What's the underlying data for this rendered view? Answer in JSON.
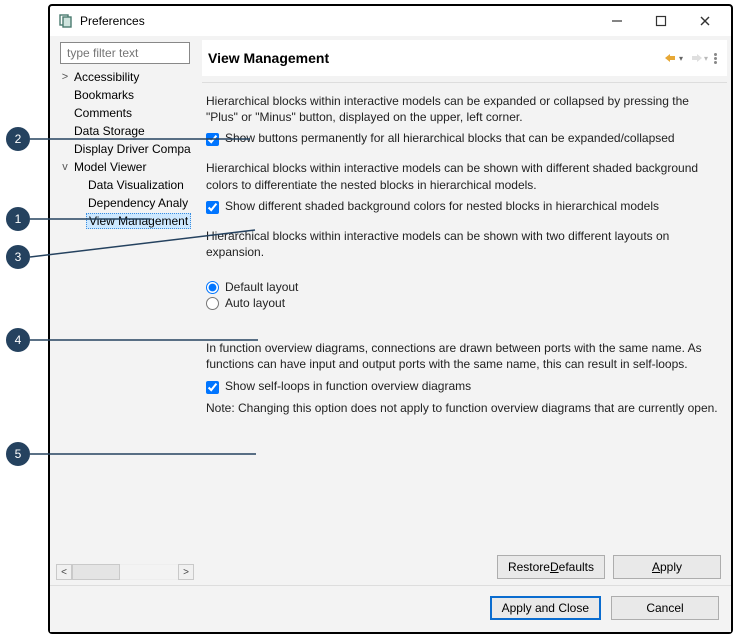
{
  "window": {
    "title": "Preferences"
  },
  "filter_placeholder": "type filter text",
  "tree": {
    "items": [
      {
        "label": "Accessibility",
        "indent": 1,
        "twisty": ">"
      },
      {
        "label": "Bookmarks",
        "indent": 1,
        "twisty": ""
      },
      {
        "label": "Comments",
        "indent": 1,
        "twisty": ""
      },
      {
        "label": "Data Storage",
        "indent": 1,
        "twisty": ""
      },
      {
        "label": "Display Driver Compa",
        "indent": 1,
        "twisty": ""
      },
      {
        "label": "Model Viewer",
        "indent": 1,
        "twisty": "v"
      },
      {
        "label": "Data Visualization",
        "indent": 2,
        "twisty": ""
      },
      {
        "label": "Dependency Analy",
        "indent": 2,
        "twisty": ""
      },
      {
        "label": "View Management",
        "indent": 2,
        "twisty": "",
        "selected": true
      }
    ]
  },
  "header": {
    "title": "View Management"
  },
  "sections": {
    "buttons_desc": "Hierarchical blocks within interactive models can be expanded or collapsed by pressing the \"Plus\" or \"Minus\" button, displayed on the upper, left corner.",
    "buttons_check": "Show buttons permanently for all hierarchical blocks that can be expanded/collapsed",
    "shading_desc": "Hierarchical blocks within interactive models can be shown with different shaded background colors to differentiate the nested blocks in hierarchical models.",
    "shading_check": "Show different shaded background colors for nested blocks in hierarchical models",
    "layout_desc": "Hierarchical blocks within interactive models can be shown with two different layouts on expansion.",
    "layout_default": "Default layout",
    "layout_auto": "Auto layout",
    "selfloop_desc": "In function overview diagrams, connections are drawn between ports with the same name. As functions can have input and output ports with the same name, this can result in self-loops.",
    "selfloop_check": "Show self-loops in function overview diagrams",
    "selfloop_note": "Note: Changing this option does not apply to function overview diagrams that are currently open."
  },
  "buttons": {
    "restore_pre": "Restore ",
    "restore_ul": "D",
    "restore_post": "efaults",
    "apply_pre": "",
    "apply_ul": "A",
    "apply_post": "pply",
    "apply_close": "Apply and Close",
    "cancel": "Cancel"
  },
  "callouts": [
    "1",
    "2",
    "3",
    "4",
    "5"
  ]
}
